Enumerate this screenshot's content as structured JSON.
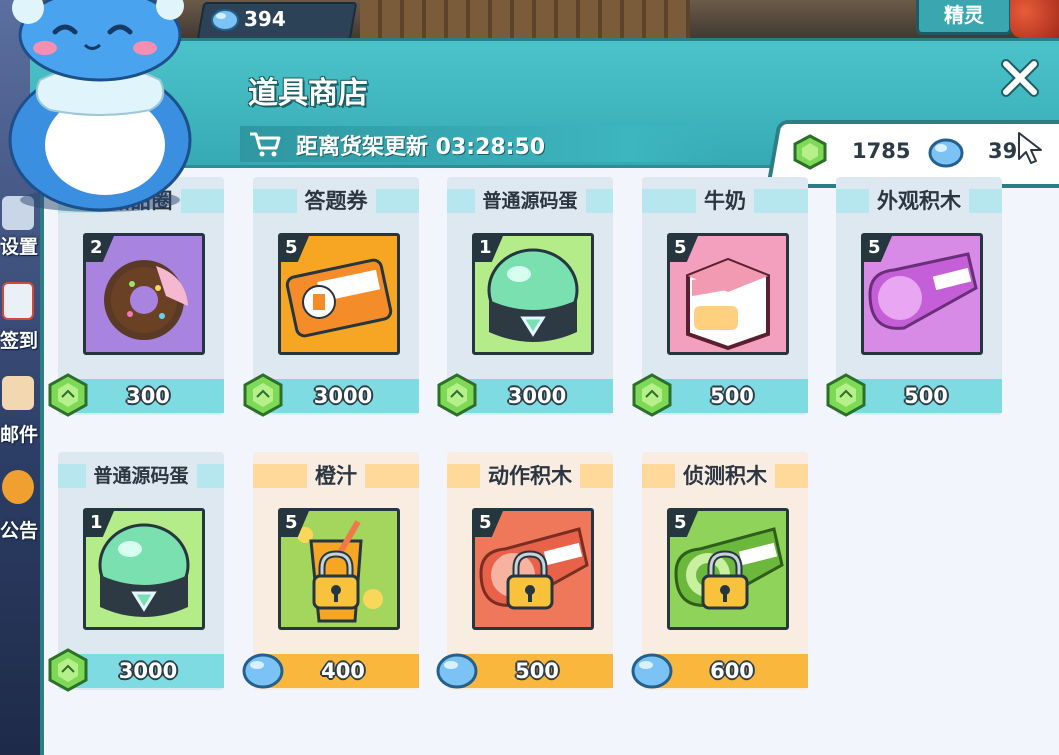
{
  "top_bar": {
    "coins": "394",
    "button_label": "精灵"
  },
  "side_menu": [
    {
      "label": "设置"
    },
    {
      "label": "签到"
    },
    {
      "label": "邮件"
    },
    {
      "label": "公告"
    }
  ],
  "shop": {
    "title": "道具商店",
    "refresh_text": "距离货架更新 03:28:50",
    "currency": {
      "gems": "1785",
      "coins": "39"
    }
  },
  "items": [
    {
      "name": "甜甜圈",
      "count": "2",
      "price": "300",
      "currency": "gem",
      "locked": false,
      "icon": "donut-icon",
      "color": "#a883e0"
    },
    {
      "name": "答题券",
      "count": "5",
      "price": "3000",
      "currency": "gem",
      "locked": false,
      "icon": "ticket-icon",
      "color": "#f6a623"
    },
    {
      "name": "普通源码蛋",
      "count": "1",
      "price": "3000",
      "currency": "gem",
      "locked": false,
      "icon": "egg-icon",
      "color": "#b5ec8a"
    },
    {
      "name": "牛奶",
      "count": "5",
      "price": "500",
      "currency": "gem",
      "locked": false,
      "icon": "milk-icon",
      "color": "#f3a0bf"
    },
    {
      "name": "外观积木",
      "count": "5",
      "price": "500",
      "currency": "gem",
      "locked": false,
      "icon": "looks-block-icon",
      "color": "#d78ae6"
    },
    {
      "name": "普通源码蛋",
      "count": "1",
      "price": "3000",
      "currency": "gem",
      "locked": false,
      "icon": "egg-icon",
      "color": "#b5ec8a"
    },
    {
      "name": "橙汁",
      "count": "5",
      "price": "400",
      "currency": "coin",
      "locked": true,
      "icon": "orange-juice-icon",
      "color": "#a4d65e"
    },
    {
      "name": "动作积木",
      "count": "5",
      "price": "500",
      "currency": "coin",
      "locked": true,
      "icon": "motion-block-icon",
      "color": "#f0785a"
    },
    {
      "name": "侦测积木",
      "count": "5",
      "price": "600",
      "currency": "coin",
      "locked": true,
      "icon": "sensing-block-icon",
      "color": "#8fd35a"
    }
  ]
}
